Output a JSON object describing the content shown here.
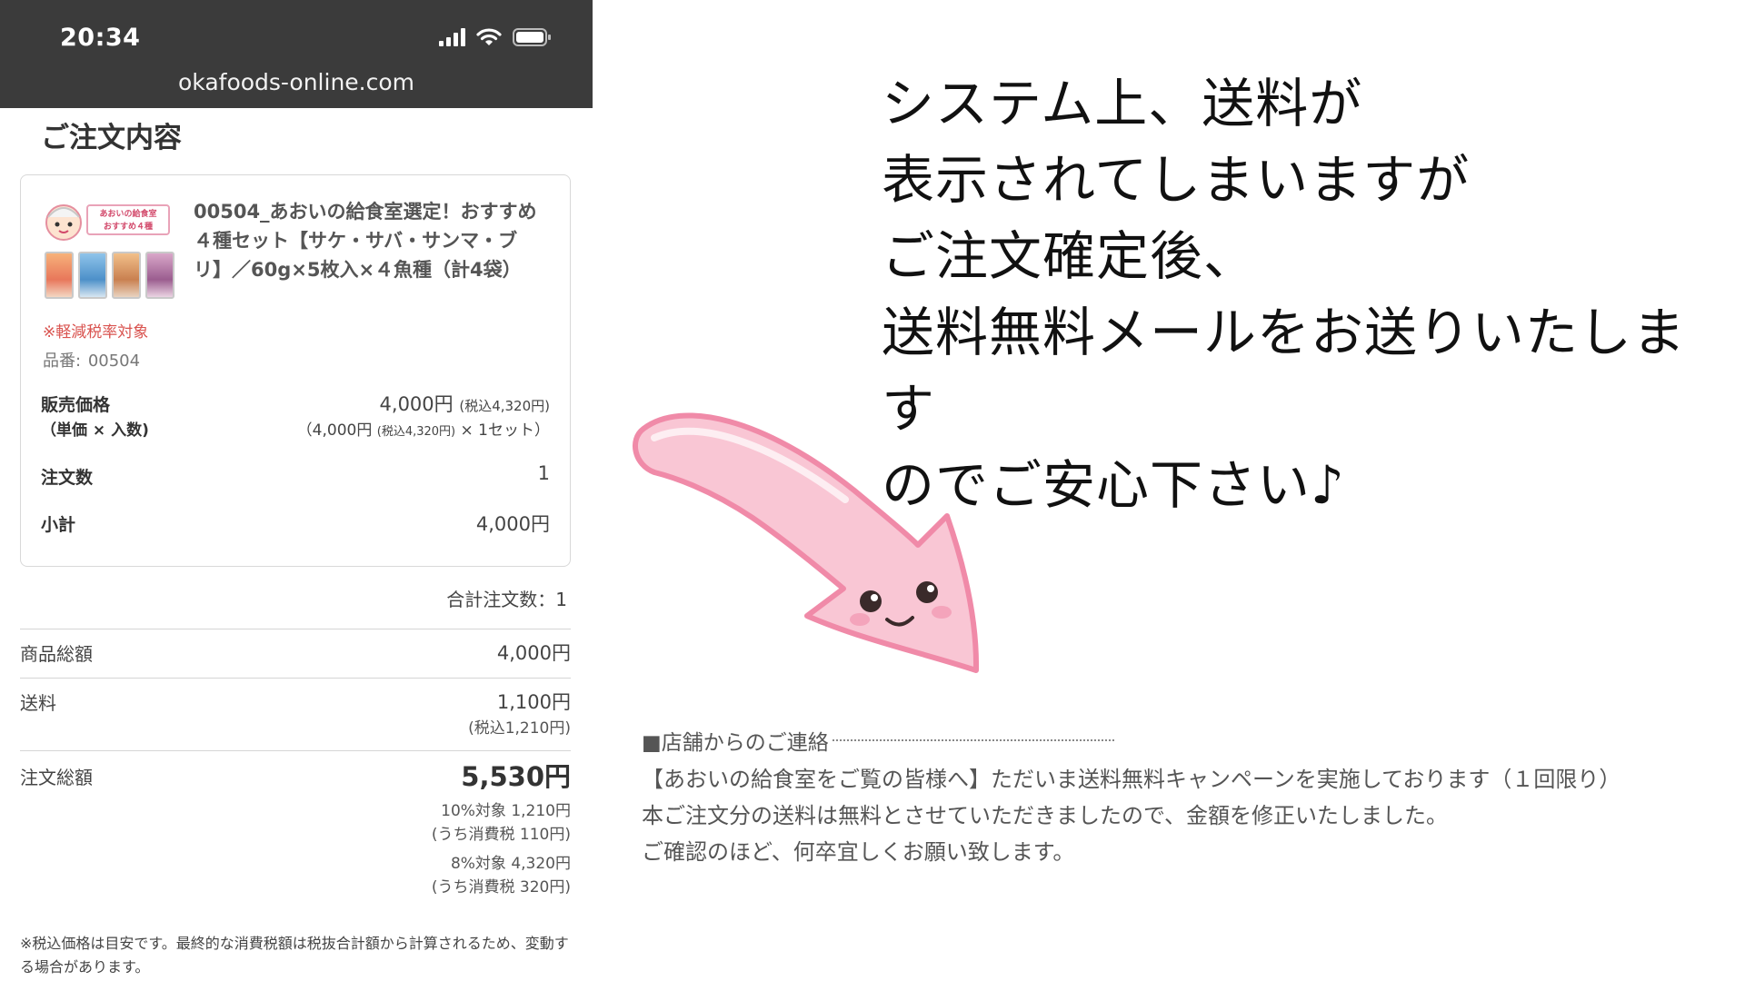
{
  "status_bar": {
    "time": "20:34",
    "url": "okafoods-online.com"
  },
  "order": {
    "title": "ご注文内容",
    "item": {
      "thumb_label": "あおいの給食室\nおすすめ４種",
      "name": "00504_あおいの給食室選定！おすすめ４種セット【サケ・サバ・サンマ・ブリ】／60g×5枚入×４魚種（計4袋）",
      "tax_note": "※軽減税率対象",
      "sku_label": "品番:",
      "sku": "00504",
      "price_label": "販売価格",
      "price_sub_label": "（単価 × 入数)",
      "price": "4,000円",
      "price_tax": "(税込4,320円)",
      "unit_price": "（4,000円",
      "unit_tax": "(税込4,320円)",
      "unit_qty": "× 1セット）",
      "qty_label": "注文数",
      "qty": "1",
      "subtotal_label": "小計",
      "subtotal": "4,000円"
    },
    "total_count": "合計注文数：1",
    "summary": {
      "goods_label": "商品総額",
      "goods": "4,000円",
      "shipping_label": "送料",
      "shipping": "1,100円",
      "shipping_tax": "(税込1,210円)",
      "total_label": "注文総額",
      "total": "5,530円",
      "tax10": "10%対象 1,210円",
      "tax10_inner": "(うち消費税 110円)",
      "tax8": "8%対象 4,320円",
      "tax8_inner": "(うち消費税 320円)"
    },
    "footnote": "※税込価格は目安です。最終的な消費税額は税抜合計額から計算されるため、変動する場合があります。"
  },
  "notice": {
    "lines": [
      "システム上、送料が",
      "表示されてしまいますが",
      "ご注文確定後、",
      "送料無料メールをお送りいたします",
      "のでご安心下さい♪"
    ]
  },
  "email": {
    "heading": "■店舗からのご連絡",
    "lines": [
      "【あおいの給食室をご覧の皆様へ】ただいま送料無料キャンペーンを実施しております（１回限り）",
      "本ご注文分の送料は無料とさせていただきましたので、金額を修正いたしました。",
      "ご確認のほど、何卒宜しくお願い致します。"
    ]
  },
  "colors": {
    "status_bar": "#3b3b3b",
    "tax_note": "#d9534f",
    "arrow_fill": "#f9c6d4",
    "arrow_stroke": "#f08aa8"
  },
  "icons": {
    "signal": "cellular-signal-icon",
    "wifi": "wifi-icon",
    "battery": "battery-icon"
  }
}
